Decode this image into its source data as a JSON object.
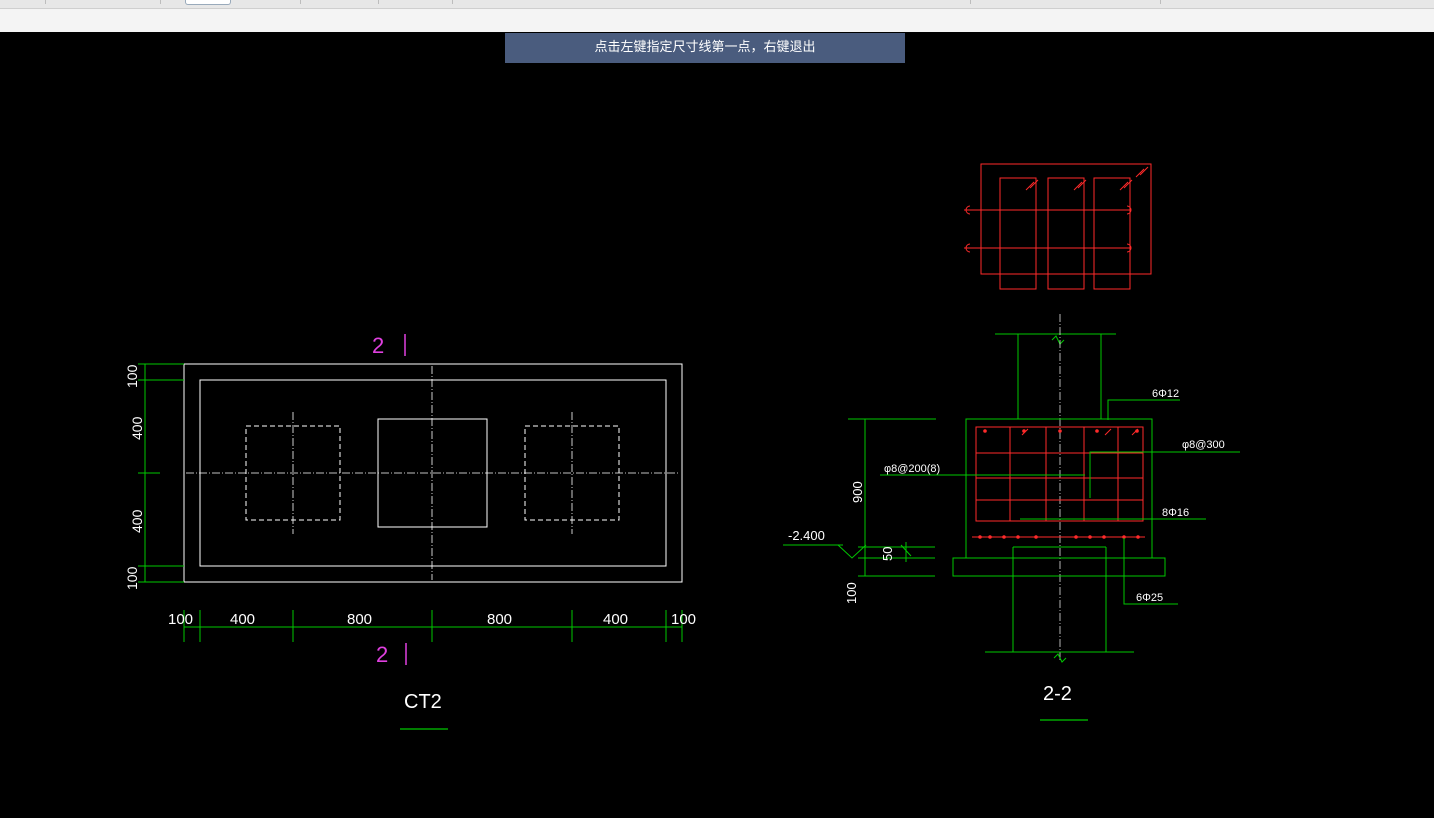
{
  "prompt": "点击左键指定尺寸线第一点，右键退出",
  "plan": {
    "title": "CT2",
    "section_marks": [
      "2",
      "2"
    ],
    "dims_bottom": [
      "100",
      "400",
      "800",
      "800",
      "400",
      "100"
    ],
    "dims_left": [
      "100",
      "400",
      "400",
      "100"
    ]
  },
  "section": {
    "title": "2-2",
    "labels": {
      "top_bar": "6Φ12",
      "stirrup_side": "φ8@300",
      "stirrup_main": "φ8@200(8)",
      "middle_bar": "8Φ16",
      "bottom_bar": "6Φ25"
    },
    "dims": {
      "height": "900",
      "cushion": "50",
      "bottom": "100",
      "elevation": "-2.400"
    }
  },
  "colors": {
    "outline": "#ffffff",
    "dimension": "#00c800",
    "rebar": "#ff2a2a",
    "section_mark": "#e040e0",
    "banner": "#4a5c7e"
  }
}
